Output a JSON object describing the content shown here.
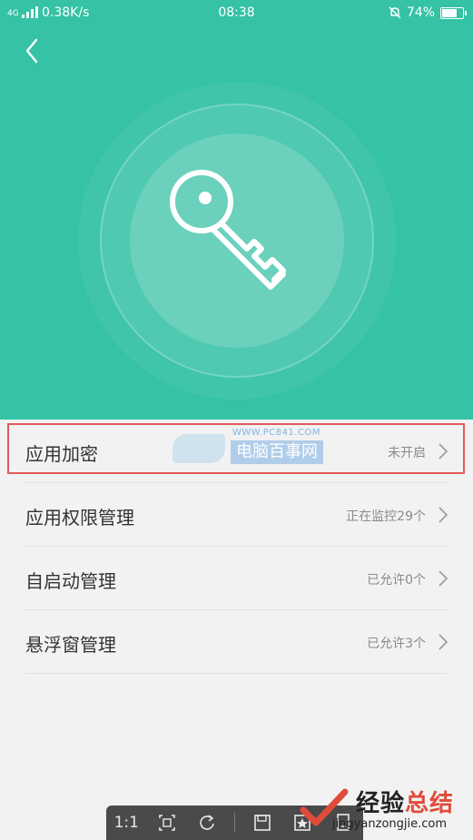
{
  "status_bar": {
    "net_label": "4G",
    "speed": "0.38K/s",
    "time": "08:38",
    "battery": "74%",
    "battery_level": 0.74
  },
  "header": {
    "back_icon": "chevron-left-icon",
    "hero_icon": "key-icon"
  },
  "colors": {
    "accent": "#35c2a5",
    "highlight": "#e25a5a"
  },
  "settings": [
    {
      "label": "应用加密",
      "status": "未开启"
    },
    {
      "label": "应用权限管理",
      "status": "正在监控29个"
    },
    {
      "label": "自启动管理",
      "status": "已允许0个"
    },
    {
      "label": "悬浮窗管理",
      "status": "已允许3个"
    }
  ],
  "watermark": {
    "url": "WWW.PC841.COM",
    "name": "电脑百事网"
  },
  "viewer_toolbar": {
    "ratio_label": "1:1"
  },
  "brand": {
    "title_a": "经验",
    "title_b": "总结",
    "subtitle": "jingyanzongjie.com"
  }
}
